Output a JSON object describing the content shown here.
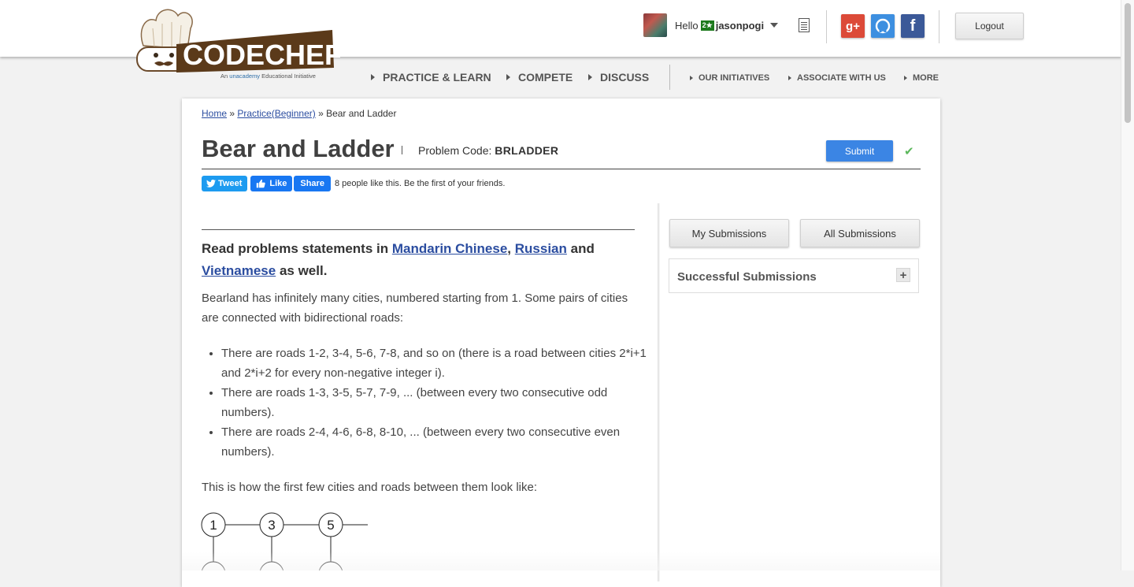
{
  "brand": {
    "logo_text": "CODECHEF",
    "tagline_prefix": "An",
    "tagline_brand": "unacademy",
    "tagline_suffix": "Educational Initiative"
  },
  "user": {
    "greeting": "Hello",
    "rating_badge": "2★",
    "username": "jasonpogi"
  },
  "social": {
    "gplus_label": "g+",
    "github_label": "⌂",
    "facebook_label": "f"
  },
  "header": {
    "logout_label": "Logout"
  },
  "nav": {
    "main": [
      "PRACTICE & LEARN",
      "COMPETE",
      "DISCUSS"
    ],
    "secondary": [
      "OUR INITIATIVES",
      "ASSOCIATE WITH US",
      "MORE"
    ]
  },
  "breadcrumb": {
    "home": "Home",
    "sep1": " » ",
    "practice": "Practice(Beginner)",
    "sep2": " » ",
    "current": "Bear and Ladder"
  },
  "problem": {
    "title": "Bear and Ladder",
    "code_label": "Problem Code:",
    "code": "BRLADDER",
    "submit_label": "Submit"
  },
  "share": {
    "tweet": "Tweet",
    "like": "Like",
    "share": "Share",
    "likes_text": "8 people like this. Be the first of your friends."
  },
  "statement": {
    "read_prefix": "Read problems statements in",
    "lang1": "Mandarin Chinese",
    "comma": ",",
    "lang2": "Russian",
    "and": "and",
    "lang3": "Vietnamese",
    "suffix": "as well.",
    "intro": "Bearland has infinitely many cities, numbered starting from 1. Some pairs of cities are connected with bidirectional roads:",
    "roads": [
      "There are roads 1-2, 3-4, 5-6, 7-8, and so on (there is a road between cities 2*i+1 and 2*i+2 for every non-negative integer i).",
      "There are roads 1-3, 3-5, 5-7, 7-9, ... (between every two consecutive odd numbers).",
      "There are roads 2-4, 4-6, 6-8, 8-10, ... (between every two consecutive even numbers)."
    ],
    "figure_caption": "This is how the first few cities and roads between them look like:",
    "figure_nodes": [
      "1",
      "3",
      "5"
    ]
  },
  "sidebar": {
    "my_submissions": "My Submissions",
    "all_submissions": "All Submissions",
    "successful_submissions": "Successful Submissions",
    "expand": "+"
  }
}
